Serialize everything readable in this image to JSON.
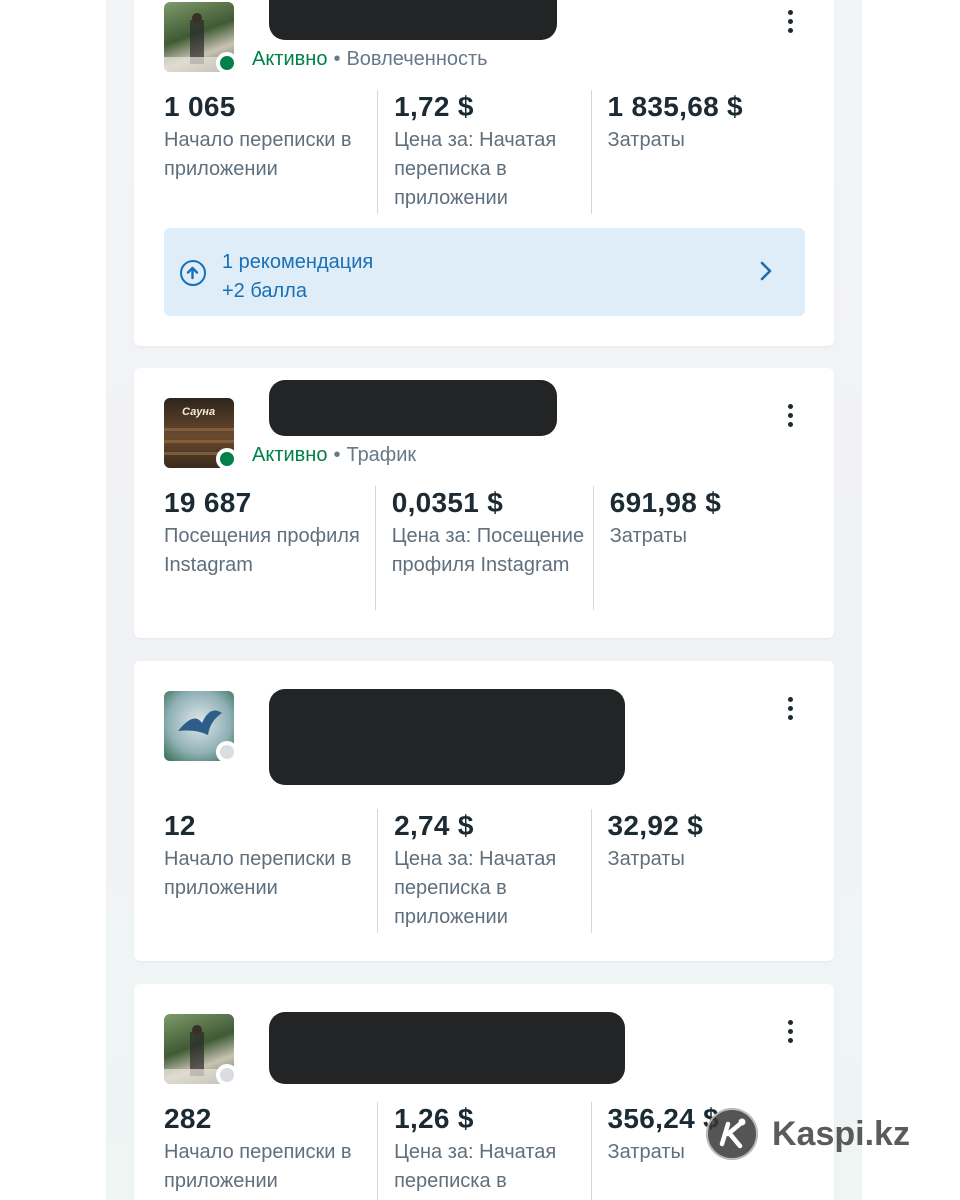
{
  "campaigns": [
    {
      "status": "Активно",
      "separator": "•",
      "objective": "Вовлеченность",
      "metrics": [
        {
          "value": "1 065",
          "label": "Начало переписки в приложении"
        },
        {
          "value": "1,72 $",
          "label": "Цена за: Начатая переписка в приложении"
        },
        {
          "value": "1 835,68 $",
          "label": "Затраты"
        }
      ],
      "recommendation": {
        "line1": "1 рекомендация",
        "line2": "+2 балла"
      }
    },
    {
      "status": "Активно",
      "separator": "•",
      "objective": "Трафик",
      "thumb_caption": "Сауна",
      "metrics": [
        {
          "value": "19 687",
          "label": "Посещения профиля Instagram"
        },
        {
          "value": "0,0351 $",
          "label": "Цена за: Посещение профиля Instagram"
        },
        {
          "value": "691,98 $",
          "label": "Затраты"
        }
      ]
    },
    {
      "metrics": [
        {
          "value": "12",
          "label": "Начало переписки в приложении"
        },
        {
          "value": "2,74 $",
          "label": "Цена за: Начатая переписка в приложении"
        },
        {
          "value": "32,92 $",
          "label": "Затраты"
        }
      ]
    },
    {
      "metrics": [
        {
          "value": "282",
          "label": "Начало переписки в приложении"
        },
        {
          "value": "1,26 $",
          "label": "Цена за: Начатая переписка в"
        },
        {
          "value": "356,24 $",
          "label": "Затраты"
        }
      ]
    }
  ],
  "watermark": {
    "text": "Kaspi.kz"
  },
  "colors": {
    "active": "#00804a",
    "link": "#1a6fb5",
    "reco_bg": "#deedf8"
  }
}
